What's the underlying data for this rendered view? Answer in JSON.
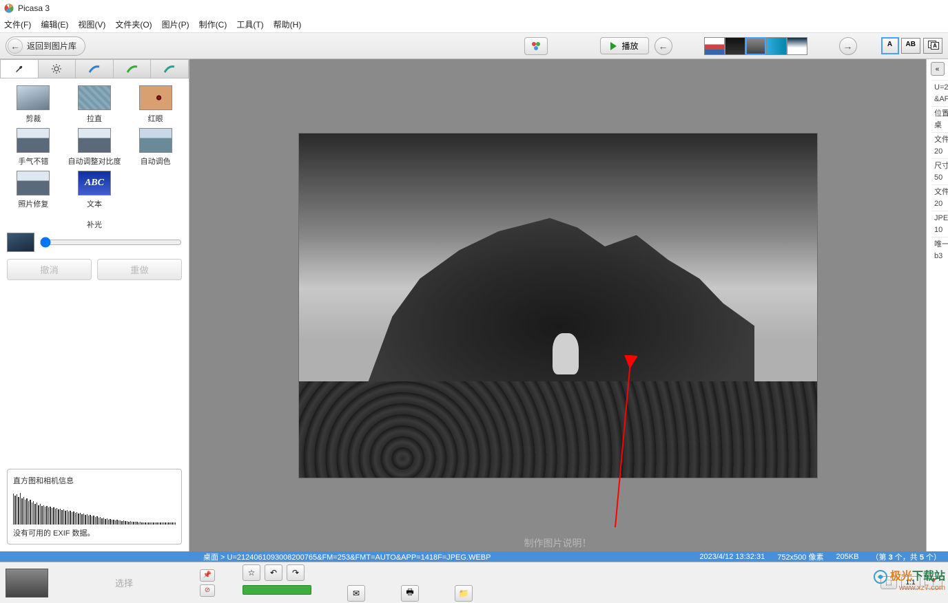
{
  "title": "Picasa 3",
  "menu": [
    "文件(F)",
    "编辑(E)",
    "视图(V)",
    "文件夹(O)",
    "图片(P)",
    "制作(C)",
    "工具(T)",
    "帮助(H)"
  ],
  "toolbar": {
    "back": "返回到图片库",
    "play": "播放",
    "view_modes": [
      "A",
      "AB"
    ]
  },
  "tabs_icons": [
    "wrench",
    "sun",
    "brush-blue",
    "brush-green",
    "brush-teal"
  ],
  "tools": {
    "crop": "剪裁",
    "straighten": "拉直",
    "redeye": "红眼",
    "lucky": "手气不错",
    "contrast": "自动调整对比度",
    "color": "自动调色",
    "retouch": "照片修复",
    "text": "文本",
    "text_thumb": "ABC",
    "fill_label": "补光"
  },
  "buttons": {
    "undo": "撤消",
    "redo": "重做"
  },
  "histogram": {
    "title": "直方图和相机信息",
    "exif": "没有可用的 EXIF 数据。"
  },
  "caption_placeholder": "制作图片说明！",
  "status": {
    "path_prefix": "桌面 > ",
    "filename": "U=2124061093008200765&FM=253&FMT=AUTO&APP=1418F=JPEG.WEBP",
    "datetime": "2023/4/12 13:32:31",
    "dimensions": "752x500 像素",
    "filesize": "205KB",
    "count_prefix": "（第 ",
    "count_mid": " 个，共 ",
    "count_suffix": " 个）",
    "index": "3",
    "total": "5"
  },
  "right_panel": {
    "line1a": "U=2",
    "line1b": "&AF",
    "loc_label": "位置",
    "loc_val": "桌",
    "date_label": "文件",
    "date_val": "20",
    "dim_label": "尺寸",
    "dim_val": "50",
    "size_label": "文件",
    "size_val": "20",
    "type_label": "JPE",
    "type_val": "10",
    "uniq_label": "唯一",
    "uniq_val": "b3"
  },
  "bottom": {
    "select": "选择",
    "one_to_one": "1:1"
  },
  "watermark": {
    "brand_a": "极光",
    "brand_b": "下载站",
    "url": "www.xz7.com"
  }
}
